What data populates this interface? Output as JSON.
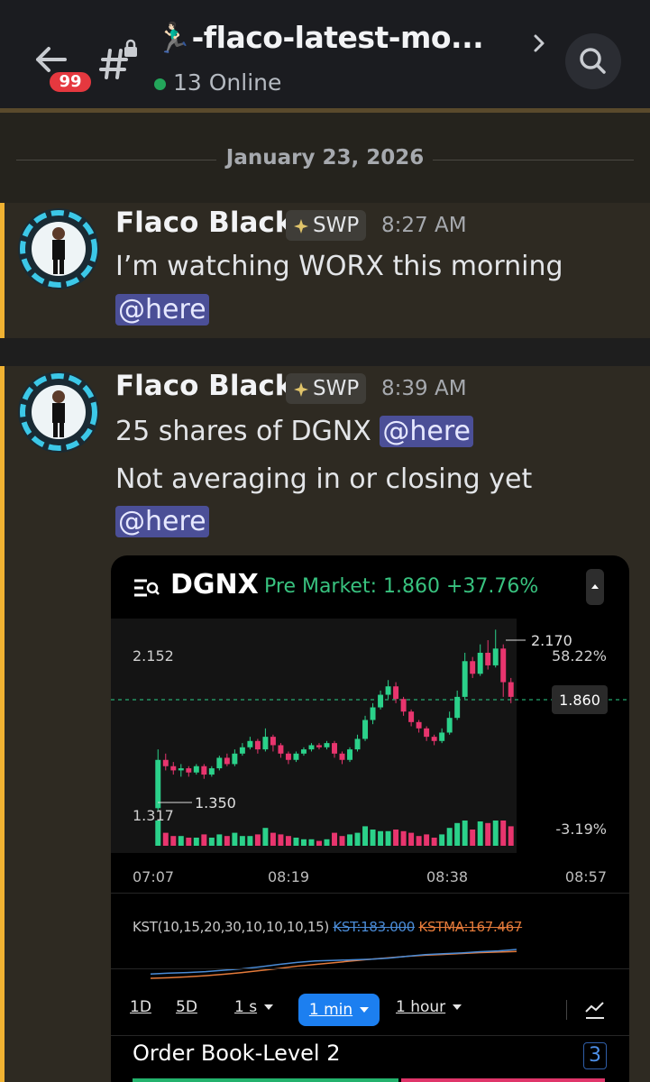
{
  "header": {
    "unread_badge": "99",
    "channel_name": "🏃🏻‍♂️-flaco-latest-mo...",
    "online_count": "13 Online"
  },
  "date_divider": "January 23, 2026",
  "messages": [
    {
      "author": "Flaco Black",
      "tag": "SWP",
      "time": "8:27 AM",
      "lines": [
        {
          "text": "I’m watching WORX this morning",
          "mention": ""
        },
        {
          "text": "",
          "mention": "@here"
        }
      ]
    },
    {
      "author": "Flaco Black",
      "tag": "SWP",
      "time": "8:39 AM",
      "lines": [
        {
          "text": "25 shares of DGNX ",
          "mention": "@here"
        },
        {
          "text": "Not averaging in or closing yet",
          "mention": ""
        },
        {
          "text": "",
          "mention": "@here"
        }
      ]
    }
  ],
  "embed": {
    "ticker": "DGNX",
    "premarket": "Pre Market: 1.860 +37.76%",
    "price_high_label": "2.152",
    "price_low_label": "1.317",
    "peak_marker": "2.170",
    "low_marker": "1.350",
    "pct_high": "58.22%",
    "pct_low": "-3.19%",
    "last_price": "1.860",
    "kst_label": "KST(10,15,20,30,10,10,10,15)",
    "kst_value": "KST:183.000",
    "kstma_value": "KSTMA:167.467",
    "timeframes": [
      "1D",
      "5D",
      "1 s",
      "1 min",
      "1 hour"
    ],
    "order_book_title": "Order Book-Level 2",
    "order_book_count": "3",
    "colors": {
      "up": "#2bd18a",
      "down": "#e8356e",
      "kst": "#4a8bd6",
      "kstma": "#e47a3a"
    }
  },
  "chart_data": {
    "type": "candlestick",
    "x_ticks": [
      "07:07",
      "08:19",
      "08:38",
      "08:57"
    ],
    "y_labels": [
      "2.152",
      "1.860",
      "1.317"
    ],
    "ylim": [
      1.3,
      2.18
    ],
    "candles": [
      [
        1.32,
        1.55,
        1.31,
        1.6
      ],
      [
        1.55,
        1.52,
        1.5,
        1.58
      ],
      [
        1.52,
        1.5,
        1.48,
        1.54
      ],
      [
        1.5,
        1.51,
        1.47,
        1.53
      ],
      [
        1.51,
        1.49,
        1.47,
        1.52
      ],
      [
        1.49,
        1.52,
        1.48,
        1.53
      ],
      [
        1.52,
        1.48,
        1.46,
        1.53
      ],
      [
        1.48,
        1.51,
        1.47,
        1.52
      ],
      [
        1.51,
        1.56,
        1.5,
        1.57
      ],
      [
        1.56,
        1.53,
        1.52,
        1.58
      ],
      [
        1.53,
        1.58,
        1.52,
        1.6
      ],
      [
        1.58,
        1.61,
        1.57,
        1.63
      ],
      [
        1.61,
        1.64,
        1.6,
        1.66
      ],
      [
        1.64,
        1.6,
        1.58,
        1.65
      ],
      [
        1.6,
        1.66,
        1.59,
        1.7
      ],
      [
        1.66,
        1.62,
        1.59,
        1.67
      ],
      [
        1.62,
        1.58,
        1.56,
        1.63
      ],
      [
        1.58,
        1.55,
        1.53,
        1.59
      ],
      [
        1.55,
        1.58,
        1.54,
        1.59
      ],
      [
        1.58,
        1.6,
        1.57,
        1.61
      ],
      [
        1.6,
        1.62,
        1.59,
        1.63
      ],
      [
        1.62,
        1.61,
        1.6,
        1.63
      ],
      [
        1.61,
        1.63,
        1.6,
        1.64
      ],
      [
        1.63,
        1.58,
        1.56,
        1.64
      ],
      [
        1.58,
        1.55,
        1.53,
        1.59
      ],
      [
        1.55,
        1.6,
        1.54,
        1.61
      ],
      [
        1.6,
        1.65,
        1.59,
        1.67
      ],
      [
        1.65,
        1.74,
        1.64,
        1.76
      ],
      [
        1.74,
        1.8,
        1.72,
        1.82
      ],
      [
        1.8,
        1.86,
        1.79,
        1.88
      ],
      [
        1.86,
        1.9,
        1.84,
        1.93
      ],
      [
        1.9,
        1.84,
        1.82,
        1.92
      ],
      [
        1.84,
        1.78,
        1.76,
        1.85
      ],
      [
        1.78,
        1.73,
        1.71,
        1.79
      ],
      [
        1.73,
        1.7,
        1.68,
        1.74
      ],
      [
        1.7,
        1.66,
        1.64,
        1.71
      ],
      [
        1.66,
        1.64,
        1.62,
        1.67
      ],
      [
        1.64,
        1.68,
        1.63,
        1.7
      ],
      [
        1.68,
        1.75,
        1.67,
        1.78
      ],
      [
        1.75,
        1.85,
        1.74,
        1.88
      ],
      [
        1.85,
        2.02,
        1.84,
        2.06
      ],
      [
        2.02,
        1.96,
        1.94,
        2.04
      ],
      [
        1.96,
        2.06,
        1.95,
        2.1
      ],
      [
        2.06,
        2.0,
        1.98,
        2.12
      ],
      [
        2.0,
        2.08,
        1.99,
        2.17
      ],
      [
        2.08,
        1.92,
        1.85,
        2.1
      ],
      [
        1.92,
        1.85,
        1.82,
        1.94
      ]
    ],
    "kst_series": [
      0.15,
      0.18,
      0.2,
      0.23,
      0.28,
      0.33,
      0.4,
      0.48,
      0.55,
      0.6,
      0.62,
      0.64,
      0.66,
      0.7,
      0.76,
      0.82,
      0.85,
      0.88,
      0.92,
      0.95,
      1.0
    ],
    "kstma_series": [
      0.0,
      0.02,
      0.05,
      0.09,
      0.14,
      0.2,
      0.27,
      0.34,
      0.42,
      0.48,
      0.54,
      0.6,
      0.66,
      0.71,
      0.76,
      0.8,
      0.83,
      0.86,
      0.89,
      0.91,
      0.93
    ]
  }
}
